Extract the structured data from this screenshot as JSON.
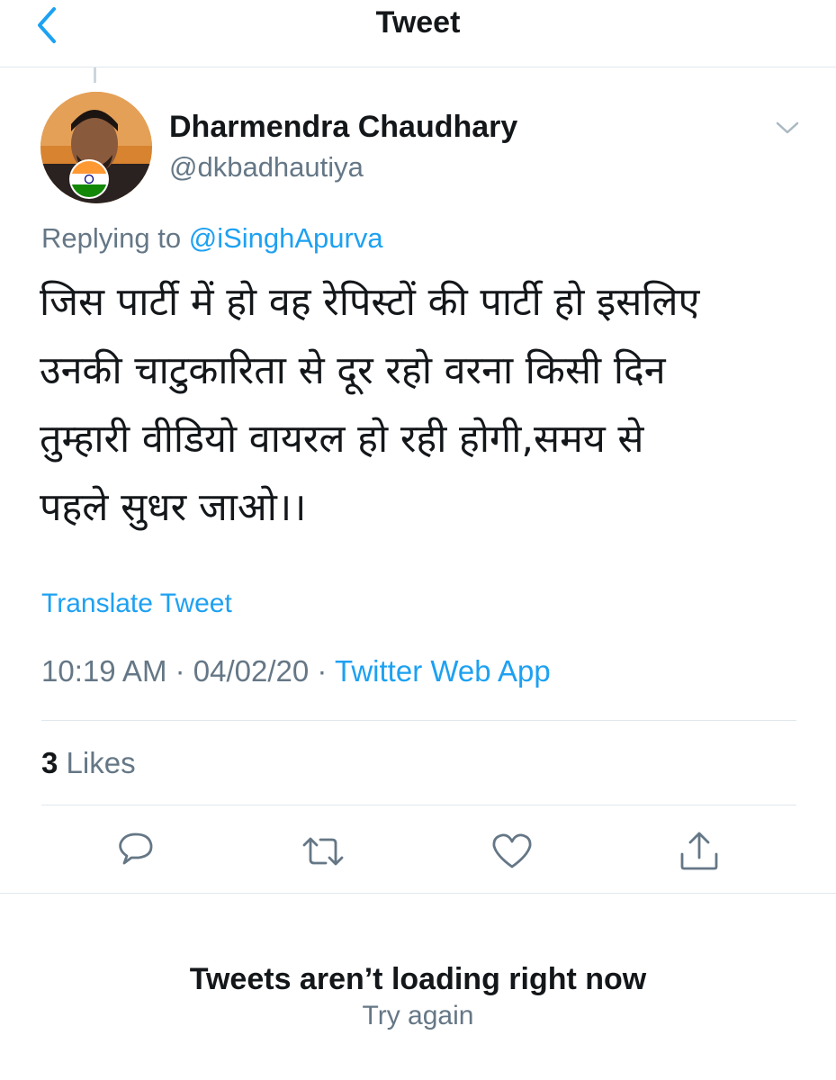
{
  "header": {
    "title": "Tweet",
    "back_icon": "chevron-left-icon"
  },
  "tweet": {
    "display_name": "Dharmendra Chaudhary",
    "handle": "@dkbadhautiya",
    "replying_prefix": "Replying to",
    "replying_to": "@iSinghApurva",
    "text": "जिस पार्टी में हो वह रेपिस्टों की पार्टी हो इसलिए\nउनकी चाटुकारिता से दूर रहो वरना किसी दिन\nतुम्हारी वीडियो वायरल हो रही होगी,समय से\nपहले सुधर जाओ।।",
    "translate_label": "Translate Tweet",
    "time": "10:19 AM",
    "date": "04/02/20",
    "separator": "·",
    "source": "Twitter Web App",
    "likes_count": "3",
    "likes_label": "Likes"
  },
  "actions": {
    "reply_icon": "reply-icon",
    "retweet_icon": "retweet-icon",
    "like_icon": "heart-icon",
    "share_icon": "share-icon"
  },
  "status": {
    "message": "Tweets aren’t loading right now",
    "retry": "Try again"
  },
  "colors": {
    "accent": "#1da1f2",
    "text_primary": "#14171a",
    "text_secondary": "#657786",
    "divider": "#e1e8ed"
  }
}
